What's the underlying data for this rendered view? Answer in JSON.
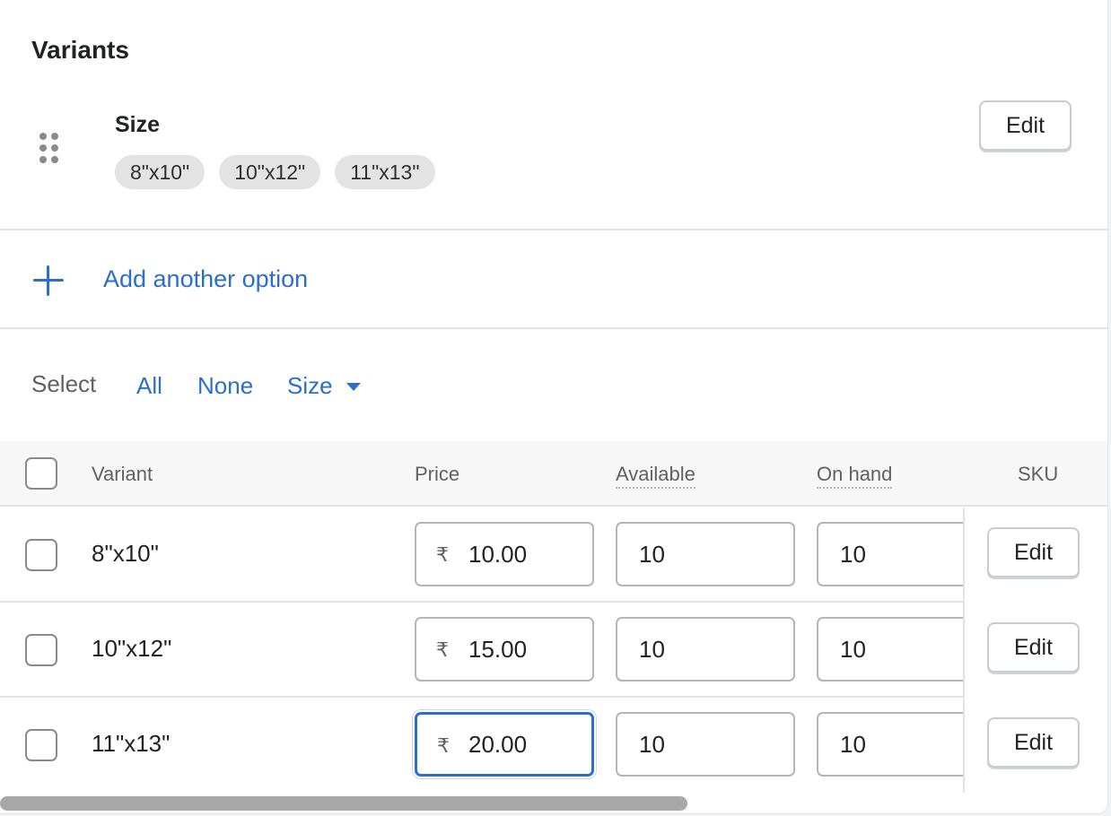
{
  "card": {
    "title": "Variants"
  },
  "option": {
    "name": "Size",
    "values": [
      "8\"x10\"",
      "10\"x12\"",
      "11\"x13\""
    ],
    "edit_label": "Edit"
  },
  "add_option": {
    "label": "Add another option"
  },
  "select": {
    "label": "Select",
    "all": "All",
    "none": "None",
    "size": "Size"
  },
  "table": {
    "headers": {
      "variant": "Variant",
      "price": "Price",
      "available": "Available",
      "on_hand": "On hand",
      "sku": "SKU"
    },
    "currency_symbol": "₹",
    "rows": [
      {
        "variant": "8\"x10\"",
        "price": "10.00",
        "available": "10",
        "on_hand": "10",
        "edit_label": "Edit"
      },
      {
        "variant": "10\"x12\"",
        "price": "15.00",
        "available": "10",
        "on_hand": "10",
        "edit_label": "Edit"
      },
      {
        "variant": "11\"x13\"",
        "price": "20.00",
        "available": "10",
        "on_hand": "10",
        "edit_label": "Edit"
      }
    ]
  },
  "colors": {
    "accent": "#2c6ecb",
    "border": "#e3e3e3",
    "pill_bg": "#e3e3e3"
  }
}
